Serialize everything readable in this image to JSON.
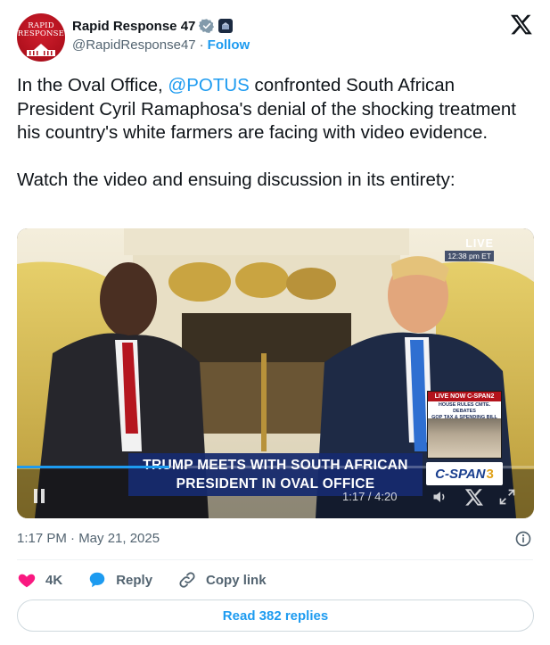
{
  "account": {
    "avatar_text_line1": "RAPID",
    "avatar_text_line2": "RESPONSE",
    "display_name": "Rapid Response 47",
    "handle": "@RapidResponse47",
    "separator": "·",
    "follow_label": "Follow",
    "verified_icon": "verified-badge-icon",
    "affiliation_icon": "affiliate-badge-icon"
  },
  "tweet": {
    "text_before_mention": "In the Oval Office, ",
    "mention": "@POTUS",
    "text_after_mention": " confronted South African President Cyril Ramaphosa's denial of the shocking treatment his country's white farmers are facing with video evidence.",
    "text_paragraph2": "Watch the video and ensuing discussion in its entirety:"
  },
  "video": {
    "live_label": "LIVE",
    "live_time": "12:38 pm ET",
    "inset_header": "LIVE NOW C-SPAN2",
    "inset_sub_line1": "HOUSE RULES CMTE. DEBATES",
    "inset_sub_line2": "GOP TAX & SPENDING BILL",
    "lower_third_line1": "TRUMP MEETS WITH SOUTH AFRICAN",
    "lower_third_line2": "PRESIDENT IN OVAL OFFICE",
    "network_logo_text": "C-SPAN",
    "network_logo_number": "3",
    "elapsed": "1:17",
    "duration": "4:20",
    "time_separator": " / ",
    "progress_fraction": 0.295
  },
  "footer": {
    "timestamp": "1:17 PM · May 21, 2025",
    "like_count": "4K",
    "reply_label": "Reply",
    "copy_link_label": "Copy link",
    "read_replies_label": "Read 382 replies"
  },
  "colors": {
    "accent": "#1d9bf0",
    "like": "#f91880",
    "text_primary": "#0f1419",
    "text_secondary": "#536471"
  }
}
